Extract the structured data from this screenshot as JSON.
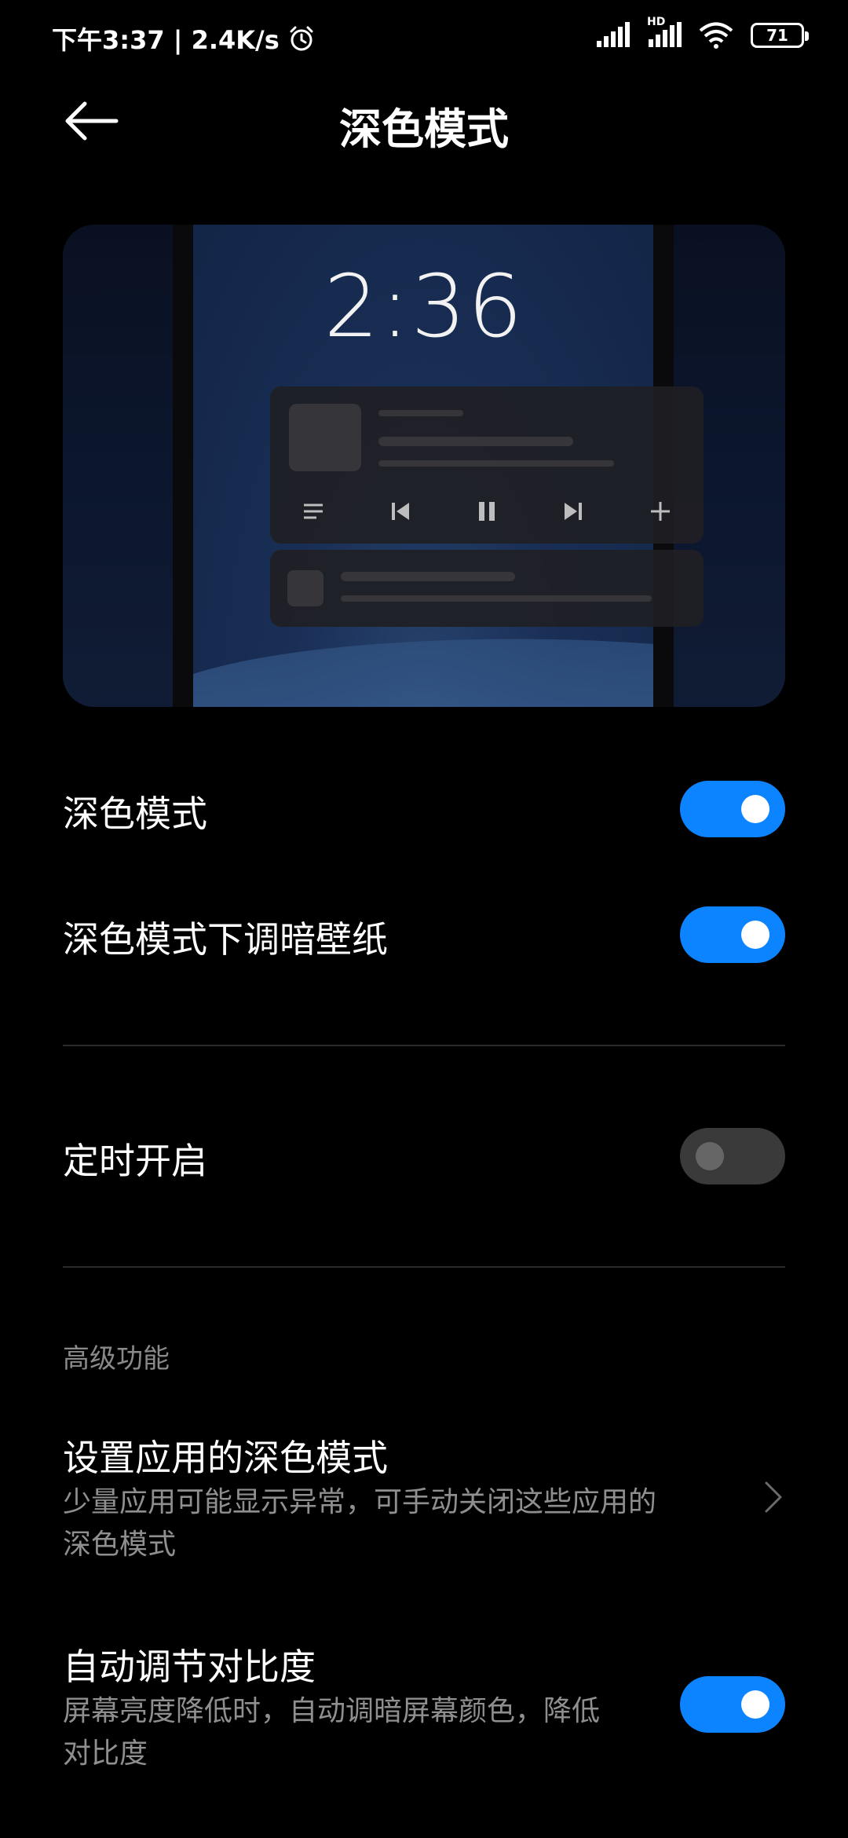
{
  "status_bar": {
    "time_speed": "下午3:37 | 2.4K/s",
    "network_label": "HD",
    "battery": "71"
  },
  "header": {
    "title": "深色模式"
  },
  "preview": {
    "clock": "2:36"
  },
  "settings": {
    "dark_mode": {
      "label": "深色模式",
      "enabled": true
    },
    "dim_wallpaper": {
      "label": "深色模式下调暗壁纸",
      "enabled": true
    },
    "schedule": {
      "label": "定时开启",
      "enabled": false
    }
  },
  "advanced": {
    "section_title": "高级功能",
    "app_dark_mode": {
      "title": "设置应用的深色模式",
      "desc_line1": "少量应用可能显示异常，可手动关闭这些应用的",
      "desc_line2": "深色模式"
    },
    "auto_contrast": {
      "title": "自动调节对比度",
      "desc_line1": "屏幕亮度降低时，自动调暗屏幕颜色，降低",
      "desc_line2": "对比度",
      "enabled": true
    }
  },
  "colors": {
    "accent": "#0d84ff",
    "background": "#000000"
  }
}
